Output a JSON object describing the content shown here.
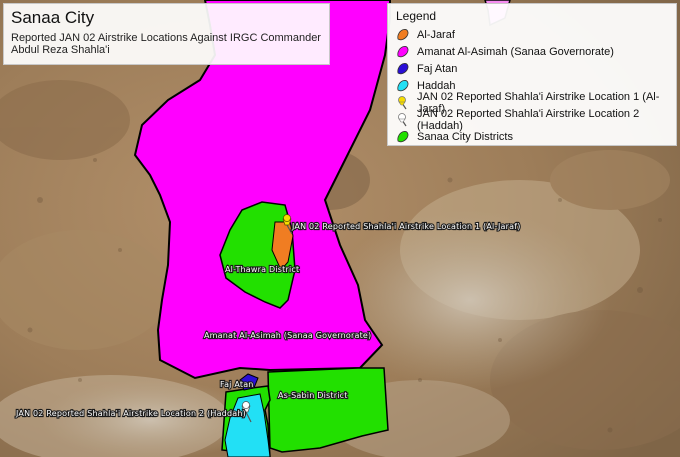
{
  "title": "Sanaa City",
  "subtitle_line1": "Reported JAN 02 Airstrike Locations Against IRGC Commander",
  "subtitle_line2": "Abdul Reza Shahla'i",
  "legend": {
    "title": "Legend",
    "items": [
      {
        "label": "Al-Jaraf",
        "color": "#f07d22",
        "icon": "polygon-swatch"
      },
      {
        "label": "Amanat Al-Asimah (Sanaa Governorate)",
        "color": "#ff00ff",
        "icon": "polygon-swatch"
      },
      {
        "label": "Faj Atan",
        "color": "#2a0fd6",
        "icon": "polygon-swatch"
      },
      {
        "label": "Haddah",
        "color": "#22e0f5",
        "icon": "polygon-swatch"
      },
      {
        "label": "JAN 02 Reported Shahla'i Airstrike Location 1 (Al-Jaraf)",
        "color": "#f5dc00",
        "icon": "pushpin-icon"
      },
      {
        "label": "JAN 02 Reported Shahla'i Airstrike Location 2 (Haddah)",
        "color": "#ffffff",
        "icon": "pushpin-icon"
      },
      {
        "label": "Sanaa City Districts",
        "color": "#22e000",
        "icon": "polygon-swatch"
      }
    ]
  },
  "map_labels": {
    "location1": "JAN 02 Reported Shahla'i Airstrike Location 1 (Al-Jaraf)",
    "al_thawra": "Al-Thawra District",
    "amanat": "Amanat Al-Asimah (Sanaa Governorate)",
    "faj_atan": "Faj Atan",
    "as_sabin": "As-Sabin District",
    "location2": "JAN 02 Reported Shahla'i Airstrike Location 2 (Haddah)"
  }
}
